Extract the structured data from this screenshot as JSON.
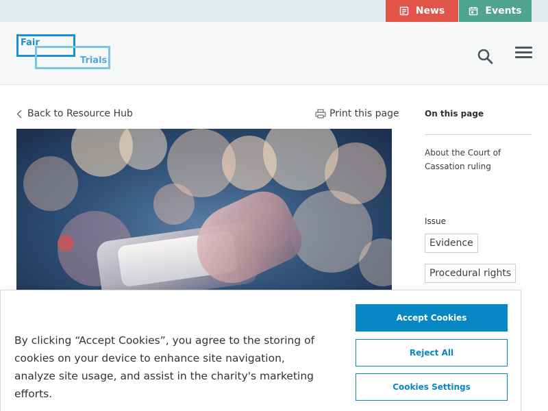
{
  "topbar": {
    "news_label": "News",
    "events_label": "Events",
    "news_icon": "news-icon",
    "events_icon": "calendar-icon"
  },
  "header": {
    "logo_word1": "Fair",
    "logo_word2": "Trials",
    "search_icon": "search-icon",
    "menu_icon": "hamburger-menu-icon"
  },
  "main": {
    "back_label": "Back to Resource Hub",
    "print_label": "Print this page"
  },
  "sidebar": {
    "on_this_page_title": "On this page",
    "links": [
      "About the Court of Cassation ruling"
    ],
    "issue_label": "Issue",
    "tags": [
      "Evidence",
      "Procedural rights"
    ]
  },
  "cookie_banner": {
    "text": "By clicking “Accept Cookies”, you agree to the storing of cookies on your device to enhance site navigation, analyze site usage, and assist in the charity's marketing efforts.",
    "accept_label": "Accept Cookies",
    "reject_label": "Reject All",
    "settings_label": "Cookies Settings"
  },
  "colors": {
    "news_bg": "#e0544a",
    "events_bg": "#4fa48f",
    "brand_blue": "#1c8fcf",
    "cookie_button": "#0787c3"
  }
}
